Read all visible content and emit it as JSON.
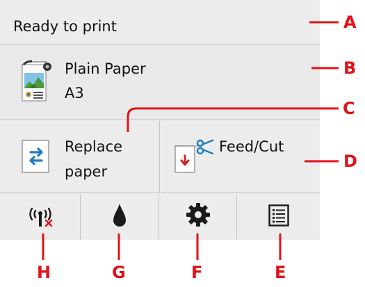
{
  "status": {
    "text": "Ready to print"
  },
  "paper": {
    "type": "Plain Paper",
    "size": "A3",
    "icon": "paper-settings-icon"
  },
  "buttons": {
    "replace_line1": "Replace",
    "replace_line2": "paper",
    "feed_cut": "Feed/Cut"
  },
  "bottom_icons": [
    "wireless-disconnected-icon",
    "ink-drop-icon",
    "gear-icon",
    "list-menu-icon"
  ],
  "callouts": {
    "a": "A",
    "b": "B",
    "c": "C",
    "d": "D",
    "e": "E",
    "f": "F",
    "g": "G",
    "h": "H"
  },
  "colors": {
    "callout": "#e1121a",
    "panel": "#ebebeb",
    "divider": "#c6c6c6",
    "icon": "#1a1a1a",
    "accent_blue": "#1f7bc2"
  }
}
